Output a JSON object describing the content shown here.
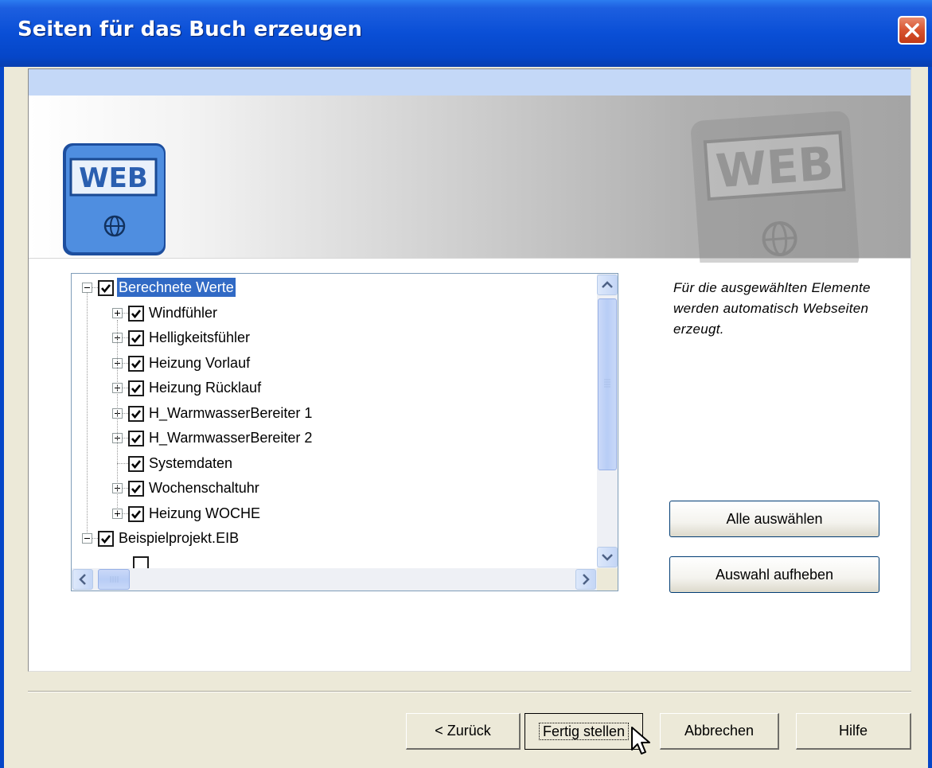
{
  "window": {
    "title": "Seiten für das Buch erzeugen"
  },
  "banner": {
    "icon_text": "WEB",
    "icon": "web-book-icon"
  },
  "tree": {
    "items": [
      {
        "label": "Berechnete Werte",
        "level": 0,
        "expander": "minus",
        "checked": true,
        "selected": true
      },
      {
        "label": "Windfühler",
        "level": 1,
        "expander": "plus",
        "checked": true
      },
      {
        "label": "Helligkeitsfühler",
        "level": 1,
        "expander": "plus",
        "checked": true
      },
      {
        "label": "Heizung Vorlauf",
        "level": 1,
        "expander": "plus",
        "checked": true
      },
      {
        "label": "Heizung Rücklauf",
        "level": 1,
        "expander": "plus",
        "checked": true
      },
      {
        "label": "H_WarmwasserBereiter 1",
        "level": 1,
        "expander": "plus",
        "checked": true
      },
      {
        "label": "H_WarmwasserBereiter 2",
        "level": 1,
        "expander": "plus",
        "checked": true
      },
      {
        "label": "Systemdaten",
        "level": 1,
        "expander": "none",
        "checked": true
      },
      {
        "label": "Wochenschaltuhr",
        "level": 1,
        "expander": "plus",
        "checked": true
      },
      {
        "label": "Heizung WOCHE",
        "level": 1,
        "expander": "plus",
        "checked": true
      },
      {
        "label": "Beispielprojekt.EIB",
        "level": 0,
        "expander": "minus",
        "checked": true
      }
    ]
  },
  "description": "Für die ausgewählten Elemente werden automatisch Webseiten erzeugt.",
  "buttons": {
    "select_all": "Alle auswählen",
    "deselect": "Auswahl aufheben",
    "back": "< Zurück",
    "finish": "Fertig stellen",
    "cancel": "Abbrechen",
    "help": "Hilfe"
  },
  "colors": {
    "titlebar": "#0a4fd6",
    "selection": "#316ac5",
    "dialog_bg": "#ece9d8"
  }
}
